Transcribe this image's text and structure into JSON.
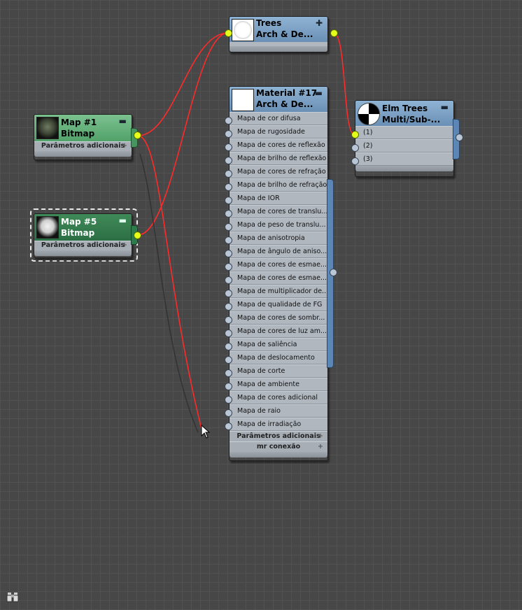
{
  "nodes": {
    "trees": {
      "title": "Trees",
      "subtitle": "Arch & De...",
      "collapse_icon": "✚"
    },
    "material17": {
      "title": "Material #17",
      "subtitle": "Arch & De...",
      "collapse_icon": "▬",
      "slots": [
        "Mapa de cor difusa",
        "Mapa de rugosidade",
        "Mapa de cores de reflexão",
        "Mapa de brilho de reflexão",
        "Mapa de cores de refração",
        "Mapa de brilho de refração",
        "Mapa de IOR",
        "Mapa de cores de translu...",
        "Mapa de peso de translu...",
        "Mapa de anisotropia",
        "Mapa de ângulo de aniso...",
        "Mapa de cores de esmae...",
        "Mapa de cores de esmae...",
        "Mapa de multiplicador de...",
        "Mapa de qualidade de FG",
        "Mapa de cores de sombr...",
        "Mapa de cores de luz am...",
        "Mapa de saliência",
        "Mapa de deslocamento",
        "Mapa de corte",
        "Mapa de ambiente",
        "Mapa de cores adicional",
        "Mapa de raio",
        "Mapa de irradiação"
      ],
      "section1": "Parâmetros adicionais",
      "section2": "mr conexão"
    },
    "map1": {
      "title": "Map #1",
      "subtitle": "Bitmap",
      "collapse_icon": "▬",
      "section": "Parâmetros adicionais"
    },
    "map5": {
      "title": "Map #5",
      "subtitle": "Bitmap",
      "collapse_icon": "▬",
      "section": "Parâmetros adicionais"
    },
    "elm": {
      "title": "Elm Trees",
      "subtitle": "Multi/Sub-...",
      "collapse_icon": "▬",
      "slots": [
        "(1)",
        "(2)",
        "(3)"
      ]
    }
  },
  "colors": {
    "wire": "#ff2a2a",
    "socket_active": "#e6ff19",
    "node_blue": "#7aa1c7",
    "node_green": "#66b27d",
    "node_selected": "#2f7a4a"
  },
  "icons": {
    "section_plus": "+",
    "cursor": "arrow-cursor-icon",
    "bottom_left": "binoculars-icon"
  }
}
